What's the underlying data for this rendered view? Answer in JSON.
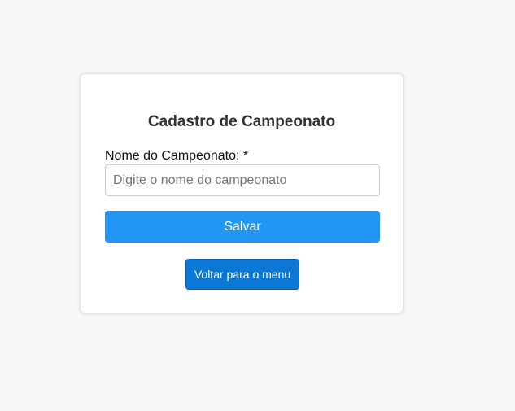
{
  "form": {
    "title": "Cadastro de Campeonato",
    "name_label": "Nome do Campeonato: *",
    "name_value": "",
    "name_placeholder": "Digite o nome do campeonato",
    "save_label": "Salvar",
    "back_label": "Voltar para o menu"
  },
  "colors": {
    "page_background": "#f8f8f8",
    "card_background": "#ffffff",
    "save_button": "#2196f3",
    "back_button": "#0a78d4"
  }
}
